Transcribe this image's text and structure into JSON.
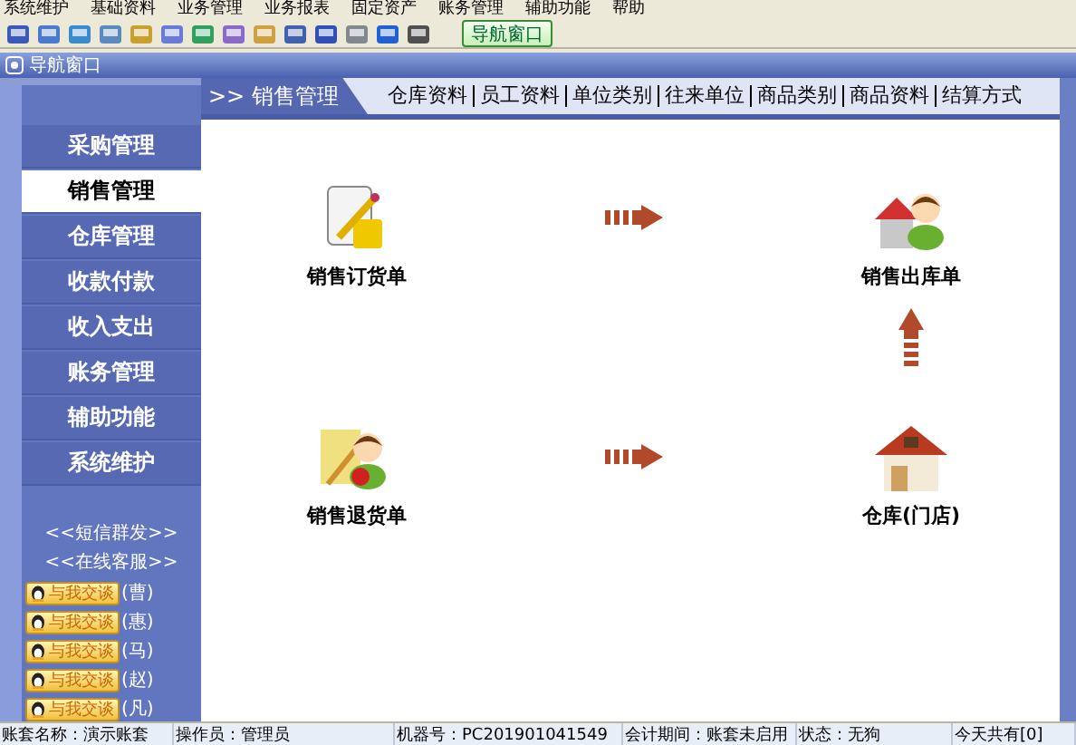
{
  "menu": [
    "系统维护",
    "基础资料",
    "业务管理",
    "业务报表",
    "固定资产",
    "账务管理",
    "辅助功能",
    "帮助"
  ],
  "toolbar": {
    "button": "导航窗口"
  },
  "panel_title": "导航窗口",
  "sidebar": {
    "items": [
      {
        "label": "采购管理",
        "selected": false
      },
      {
        "label": "销售管理",
        "selected": true
      },
      {
        "label": "仓库管理",
        "selected": false
      },
      {
        "label": "收款付款",
        "selected": false
      },
      {
        "label": "收入支出",
        "selected": false
      },
      {
        "label": "账务管理",
        "selected": false
      },
      {
        "label": "辅助功能",
        "selected": false
      },
      {
        "label": "系统维护",
        "selected": false
      }
    ],
    "links": [
      "<<短信群发>>",
      "<<在线客服>>"
    ],
    "chat": [
      {
        "button": "与我交谈",
        "name": "(曹)"
      },
      {
        "button": "与我交谈",
        "name": "(惠)"
      },
      {
        "button": "与我交谈",
        "name": "(马)"
      },
      {
        "button": "与我交谈",
        "name": "(赵)"
      },
      {
        "button": "与我交谈",
        "name": "(凡)"
      }
    ]
  },
  "header": {
    "tab": ">> 销售管理",
    "links": [
      "仓库资料",
      "员工资料",
      "单位类别",
      "往来单位",
      "商品类别",
      "商品资料",
      "结算方式"
    ]
  },
  "flow": [
    {
      "kind": "order",
      "label": "销售订货单"
    },
    {
      "kind": "arrow-right"
    },
    {
      "kind": "outbound",
      "label": "销售出库单"
    },
    {
      "kind": "blank"
    },
    {
      "kind": "blank"
    },
    {
      "kind": "arrow-up"
    },
    {
      "kind": "return",
      "label": "销售退货单"
    },
    {
      "kind": "arrow-right"
    },
    {
      "kind": "store",
      "label": "仓库(门店)"
    }
  ],
  "status": [
    "账套名称：演示账套",
    "操作员：管理员",
    "机器号：PC201901041549",
    "会计期间：账套未启用",
    "状态：无狗",
    "今天共有[0]"
  ]
}
